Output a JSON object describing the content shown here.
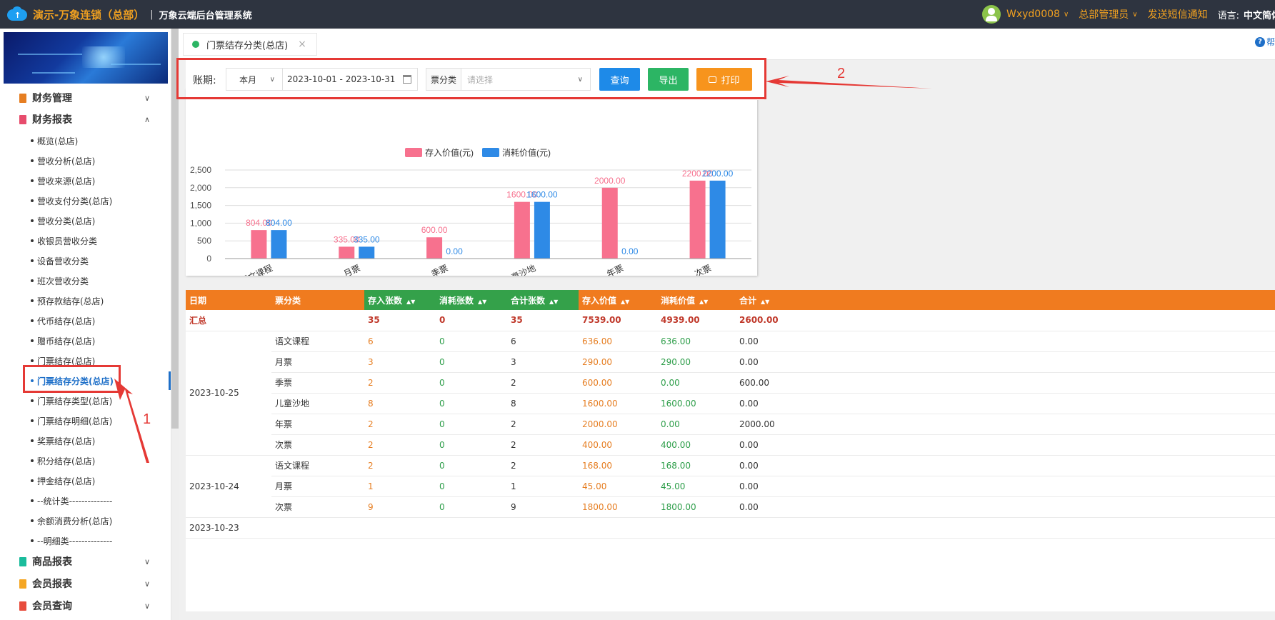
{
  "header": {
    "brand": "演示-万象连锁（总部）",
    "separator": "|",
    "system_name": "万象云端后台管理系统",
    "username": "Wxyd0008",
    "role": "总部管理员",
    "sms": "发送短信通知",
    "lang_label": "语言:",
    "lang_value": "中文简体"
  },
  "sidebar": {
    "groups": [
      {
        "label": "财务管理",
        "expanded": false,
        "color": "#e67e22"
      },
      {
        "label": "财务报表",
        "expanded": true,
        "color": "#e74c6c"
      },
      {
        "label": "商品报表",
        "expanded": false,
        "color": "#1abc9c"
      },
      {
        "label": "会员报表",
        "expanded": false,
        "color": "#f5a623"
      },
      {
        "label": "会员查询",
        "expanded": false,
        "color": "#e74c3c"
      }
    ],
    "items": [
      "概览(总店)",
      "营收分析(总店)",
      "营收来源(总店)",
      "营收支付分类(总店)",
      "营收分类(总店)",
      "收银员营收分类",
      "设备营收分类",
      "班次营收分类",
      "预存款结存(总店)",
      "代币结存(总店)",
      "赠币结存(总店)",
      "门票结存(总店)",
      "门票结存分类(总店)",
      "门票结存类型(总店)",
      "门票结存明细(总店)",
      "奖票结存(总店)",
      "积分结存(总店)",
      "押金结存(总店)",
      "--统计类--------------",
      "余额消费分析(总店)",
      "--明细类--------------"
    ],
    "active_index": 12
  },
  "annotations": {
    "one": "1",
    "two": "2"
  },
  "tabs": {
    "active": "门票结存分类(总店)",
    "close": "×",
    "help": "帮"
  },
  "filter": {
    "period_label": "账期:",
    "period_select": "本月",
    "date_range": "2023-10-01 - 2023-10-31",
    "category_label": "票分类",
    "category_placeholder": "请选择",
    "query": "查询",
    "export": "导出",
    "print": "打印"
  },
  "chart_data": {
    "type": "bar",
    "categories": [
      "语文课程",
      "月票",
      "季票",
      "儿童沙地",
      "年票",
      "次票"
    ],
    "series": [
      {
        "name": "存入价值(元)",
        "color": "#f7718e",
        "values": [
          804.0,
          335.0,
          600.0,
          1600.0,
          2000.0,
          2200.0
        ]
      },
      {
        "name": "消耗价值(元)",
        "color": "#2e8ae6",
        "values": [
          804.0,
          335.0,
          0.0,
          1600.0,
          0.0,
          2200.0
        ]
      }
    ],
    "ylim": [
      0,
      2500
    ],
    "yticks": [
      "0",
      "500",
      "1,000",
      "1,500",
      "2,000",
      "2,500"
    ],
    "grid": true,
    "legend_position": "top"
  },
  "table": {
    "columns": [
      {
        "label": "日期",
        "sortable": false,
        "green": false
      },
      {
        "label": "票分类",
        "sortable": false,
        "green": false
      },
      {
        "label": "存入张数",
        "sortable": true,
        "green": true
      },
      {
        "label": "消耗张数",
        "sortable": true,
        "green": true
      },
      {
        "label": "合计张数",
        "sortable": true,
        "green": true
      },
      {
        "label": "存入价值",
        "sortable": true,
        "green": false
      },
      {
        "label": "消耗价值",
        "sortable": true,
        "green": false
      },
      {
        "label": "合计",
        "sortable": true,
        "green": false
      }
    ],
    "summary": [
      "汇总",
      "",
      "35",
      "0",
      "35",
      "7539.00",
      "4939.00",
      "2600.00"
    ],
    "groups": [
      {
        "date": "2023-10-25",
        "rows": [
          [
            "语文课程",
            "6",
            "0",
            "6",
            "636.00",
            "636.00",
            "0.00"
          ],
          [
            "月票",
            "3",
            "0",
            "3",
            "290.00",
            "290.00",
            "0.00"
          ],
          [
            "季票",
            "2",
            "0",
            "2",
            "600.00",
            "0.00",
            "600.00"
          ],
          [
            "儿童沙地",
            "8",
            "0",
            "8",
            "1600.00",
            "1600.00",
            "0.00"
          ],
          [
            "年票",
            "2",
            "0",
            "2",
            "2000.00",
            "0.00",
            "2000.00"
          ],
          [
            "次票",
            "2",
            "0",
            "2",
            "400.00",
            "400.00",
            "0.00"
          ]
        ]
      },
      {
        "date": "2023-10-24",
        "rows": [
          [
            "语文课程",
            "2",
            "0",
            "2",
            "168.00",
            "168.00",
            "0.00"
          ],
          [
            "月票",
            "1",
            "0",
            "1",
            "45.00",
            "45.00",
            "0.00"
          ],
          [
            "次票",
            "9",
            "0",
            "9",
            "1800.00",
            "1800.00",
            "0.00"
          ]
        ]
      },
      {
        "date": "2023-10-23",
        "rows": []
      }
    ]
  }
}
